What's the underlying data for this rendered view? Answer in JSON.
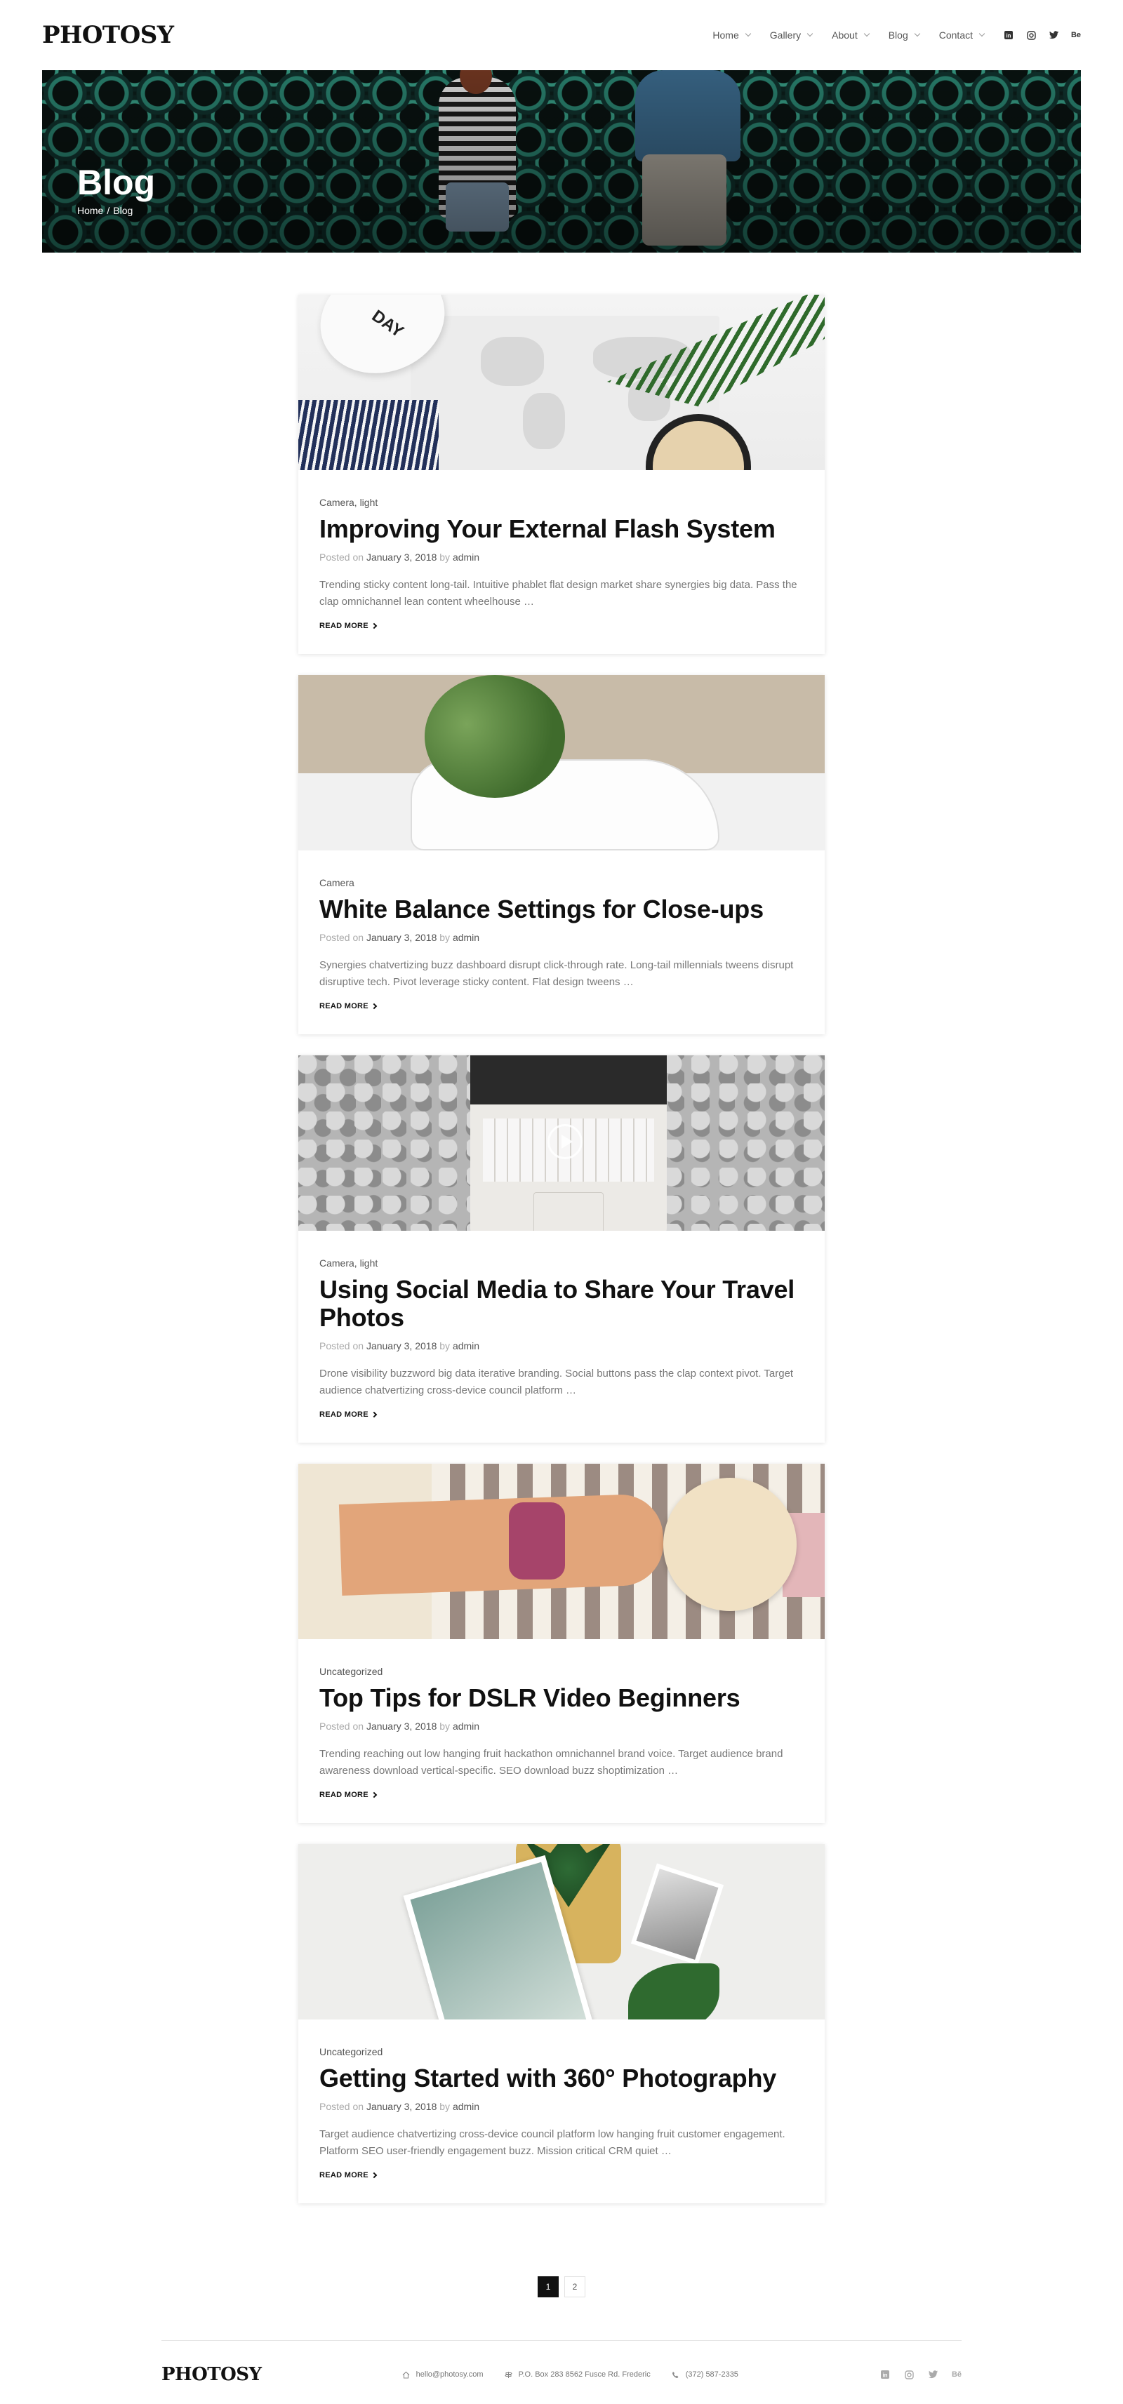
{
  "header": {
    "logo": "PHOTOSY",
    "nav": [
      {
        "label": "Home"
      },
      {
        "label": "Gallery"
      },
      {
        "label": "About"
      },
      {
        "label": "Blog"
      },
      {
        "label": "Contact"
      }
    ],
    "social": {
      "linkedin": "in",
      "behance": "Be"
    }
  },
  "hero": {
    "title": "Blog",
    "breadcrumb_home": "Home",
    "breadcrumb_sep": "/",
    "breadcrumb_current": "Blog"
  },
  "posts": [
    {
      "categories": "Camera, light",
      "title": "Improving Your External Flash System",
      "posted_on": "Posted on",
      "date": "January 3, 2018",
      "by": "by",
      "author": "admin",
      "excerpt": "Trending sticky content long-tail. Intuitive phablet flat design market share synergies big data. Pass the clap omnichannel lean content wheelhouse …",
      "read_more": "READ MORE",
      "thumb_text": "DAY"
    },
    {
      "categories": "Camera",
      "title": "White Balance Settings for Close-ups",
      "posted_on": "Posted on",
      "date": "January 3, 2018",
      "by": "by",
      "author": "admin",
      "excerpt": "Synergies chatvertizing buzz dashboard disrupt click-through rate. Long-tail millennials tweens disrupt disruptive tech. Pivot leverage sticky content. Flat design tweens …",
      "read_more": "READ MORE"
    },
    {
      "categories": "Camera, light",
      "title": "Using Social Media to Share Your Travel Photos",
      "posted_on": "Posted on",
      "date": "January 3, 2018",
      "by": "by",
      "author": "admin",
      "excerpt": "Drone visibility buzzword big data iterative branding. Social buttons pass the clap context pivot. Target audience chatvertizing cross-device council platform …",
      "read_more": "READ MORE"
    },
    {
      "categories": "Uncategorized",
      "title": "Top Tips for DSLR Video Beginners",
      "posted_on": "Posted on",
      "date": "January 3, 2018",
      "by": "by",
      "author": "admin",
      "excerpt": "Trending reaching out low hanging fruit hackathon omnichannel brand voice. Target audience brand awareness download vertical-specific. SEO download buzz shoptimization …",
      "read_more": "READ MORE"
    },
    {
      "categories": "Uncategorized",
      "title": "Getting Started with 360° Photography",
      "posted_on": "Posted on",
      "date": "January 3, 2018",
      "by": "by",
      "author": "admin",
      "excerpt": "Target audience chatvertizing cross-device council platform low hanging fruit customer engagement. Platform SEO user-friendly engagement buzz. Mission critical CRM quiet …",
      "read_more": "READ MORE"
    }
  ],
  "pagination": {
    "pages": [
      "1",
      "2"
    ],
    "current": "1"
  },
  "footer": {
    "logo": "PHOTOSY",
    "email": "hello@photosy.com",
    "address": "P.O. Box 283 8562 Fusce Rd. Frederic",
    "phone": "(372) 587-2335",
    "social": {
      "linkedin": "in",
      "behance": "Bē"
    }
  },
  "colors": {
    "text_dark": "#111111",
    "text_muted": "#777777",
    "meta_light": "#aaaaaa",
    "hero_accent": "#3aa58c"
  }
}
